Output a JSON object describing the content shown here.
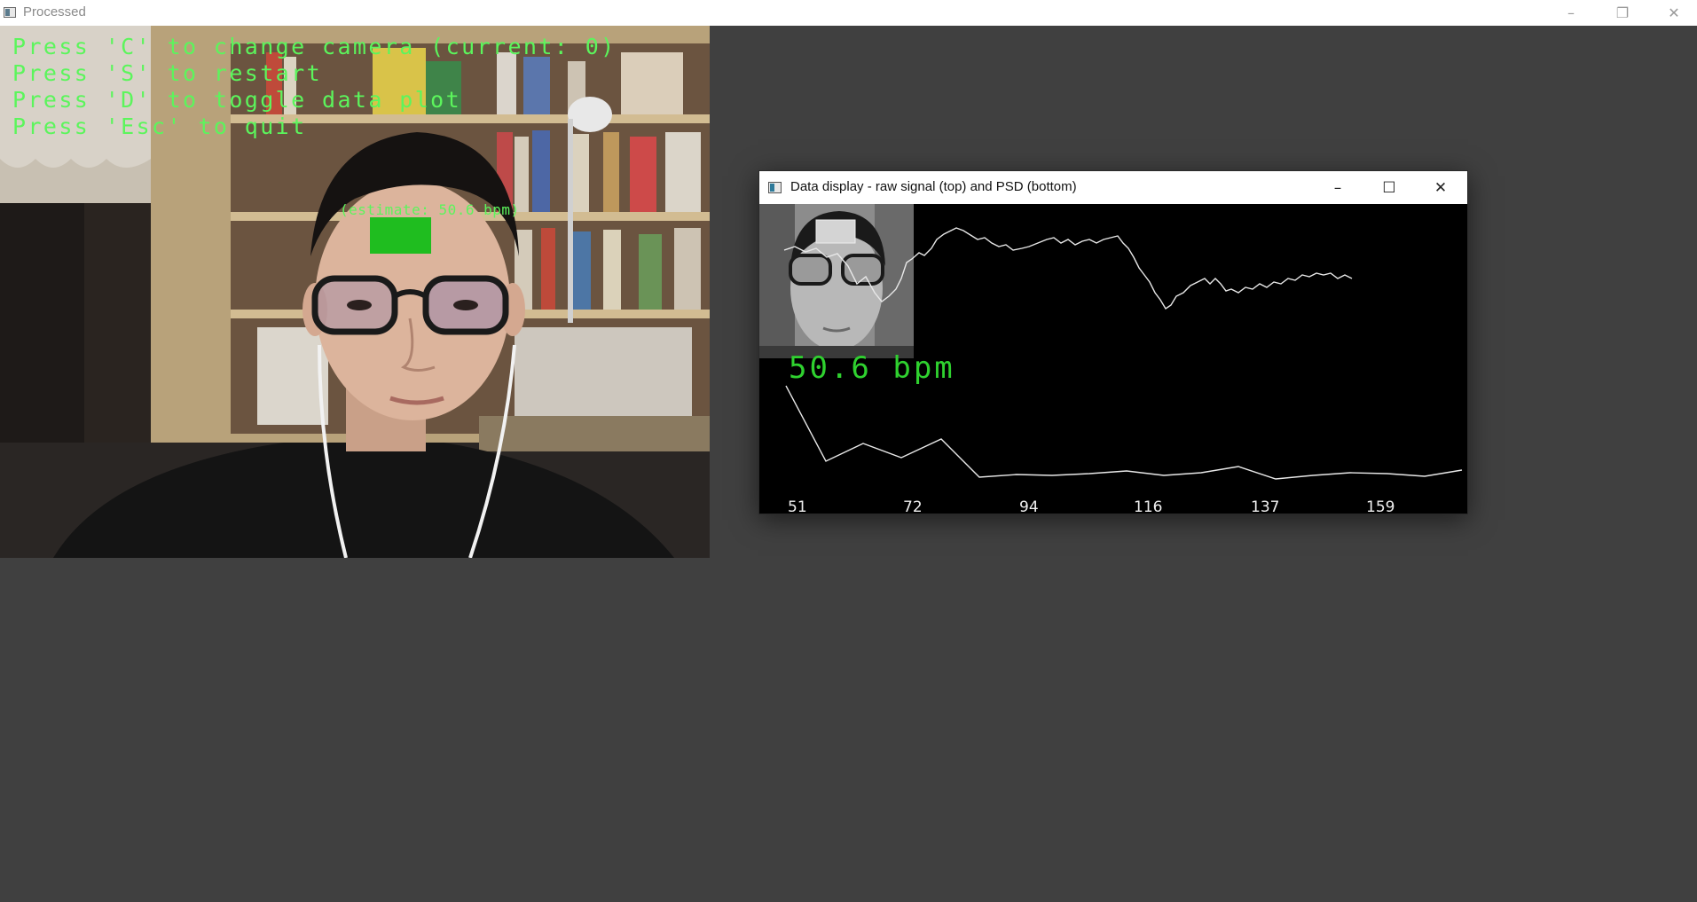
{
  "main_window": {
    "title": "Processed",
    "controls": {
      "minimize": "–",
      "restore": "❐",
      "close": "✕"
    }
  },
  "overlay": {
    "lines": [
      "Press 'C' to change camera (current: 0)",
      "Press 'S' to restart",
      "Press 'D' to toggle data plot",
      "Press 'Esc' to quit"
    ],
    "estimate": "(estimate: 50.6 bpm)",
    "text_color": "#5cf55c",
    "roi_color": "#1fbd1f"
  },
  "data_window": {
    "title": "Data display - raw signal (top) and PSD (bottom)",
    "controls": {
      "minimize": "–",
      "maximize": "☐",
      "close": "✕"
    },
    "bpm_label": "50.6 bpm",
    "bpm_color": "#2fd12f",
    "x_ticks": [
      "51",
      "72",
      "94",
      "116",
      "137",
      "159"
    ]
  }
}
